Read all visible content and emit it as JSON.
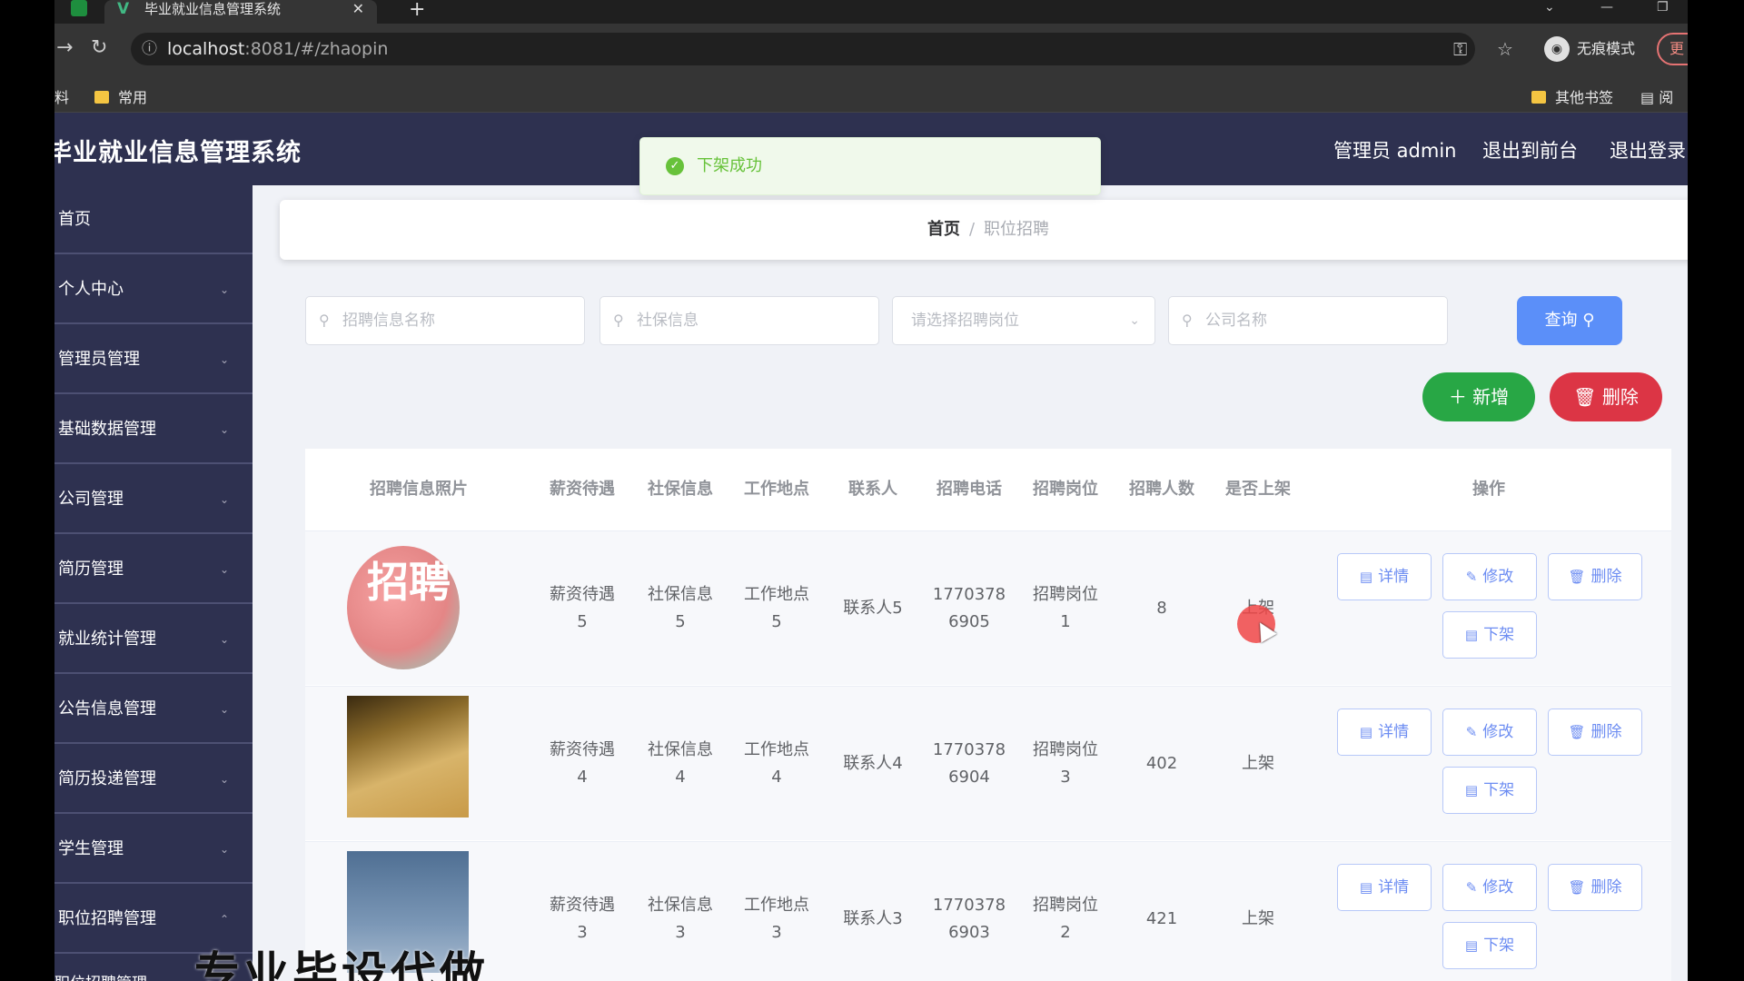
{
  "browser": {
    "tab_title": "毕业就业信息管理系统",
    "url_host": "localhost",
    "url_path": ":8081/#/zhaopin",
    "incognito_label": "无痕模式",
    "update_label": "更",
    "bookmarks": {
      "left_partial": "料",
      "common": "常用",
      "other": "其他书签",
      "reading_partial": "阅"
    }
  },
  "header": {
    "title": "毕业就业信息管理系统",
    "admin": "管理员 admin",
    "to_front": "退出到前台",
    "logout": "退出登录"
  },
  "sidebar": {
    "items": [
      {
        "label": "首页",
        "chevron": false
      },
      {
        "label": "个人中心",
        "chevron": true
      },
      {
        "label": "管理员管理",
        "chevron": true
      },
      {
        "label": "基础数据管理",
        "chevron": true
      },
      {
        "label": "公司管理",
        "chevron": true
      },
      {
        "label": "简历管理",
        "chevron": true
      },
      {
        "label": "就业统计管理",
        "chevron": true
      },
      {
        "label": "公告信息管理",
        "chevron": true
      },
      {
        "label": "简历投递管理",
        "chevron": true
      },
      {
        "label": "学生管理",
        "chevron": true
      },
      {
        "label": "职位招聘管理",
        "chevron": true,
        "expanded": true
      }
    ],
    "sub_partial": "职位招聘管理"
  },
  "breadcrumb": {
    "home": "首页",
    "sep": "/",
    "current": "职位招聘"
  },
  "search": {
    "name_placeholder": "招聘信息名称",
    "social_placeholder": "社保信息",
    "position_placeholder": "请选择招聘岗位",
    "company_placeholder": "公司名称",
    "query_label": "查询"
  },
  "actions": {
    "add_label": "新增",
    "delete_label": "删除"
  },
  "table": {
    "headers": [
      "招聘信息照片",
      "薪资待遇",
      "社保信息",
      "工作地点",
      "联系人",
      "招聘电话",
      "招聘岗位",
      "招聘人数",
      "是否上架",
      "操作"
    ],
    "rows": [
      {
        "salary": [
          "薪资待遇",
          "5"
        ],
        "social": [
          "社保信息",
          "5"
        ],
        "location": [
          "工作地点",
          "5"
        ],
        "contact": "联系人5",
        "phone": [
          "1770378",
          "6905"
        ],
        "position": [
          "招聘岗位",
          "1"
        ],
        "count": "8",
        "listed": "上架",
        "image_text": "招聘"
      },
      {
        "salary": [
          "薪资待遇",
          "4"
        ],
        "social": [
          "社保信息",
          "4"
        ],
        "location": [
          "工作地点",
          "4"
        ],
        "contact": "联系人4",
        "phone": [
          "1770378",
          "6904"
        ],
        "position": [
          "招聘岗位",
          "3"
        ],
        "count": "402",
        "listed": "上架"
      },
      {
        "salary": [
          "薪资待遇",
          "3"
        ],
        "social": [
          "社保信息",
          "3"
        ],
        "location": [
          "工作地点",
          "3"
        ],
        "contact": "联系人3",
        "phone": [
          "1770378",
          "6903"
        ],
        "position": [
          "招聘岗位",
          "2"
        ],
        "count": "421",
        "listed": "上架"
      }
    ],
    "ops": {
      "detail": "详情",
      "edit": "修改",
      "delete": "删除",
      "offshelf": "下架"
    }
  },
  "toast": {
    "message": "下架成功"
  },
  "overlay_text": "专业毕设代做",
  "colors": {
    "sidebar": "#2e3150",
    "success": "#67c23a",
    "primary": "#5b8ff9",
    "add": "#28a745",
    "danger": "#dc3545"
  }
}
